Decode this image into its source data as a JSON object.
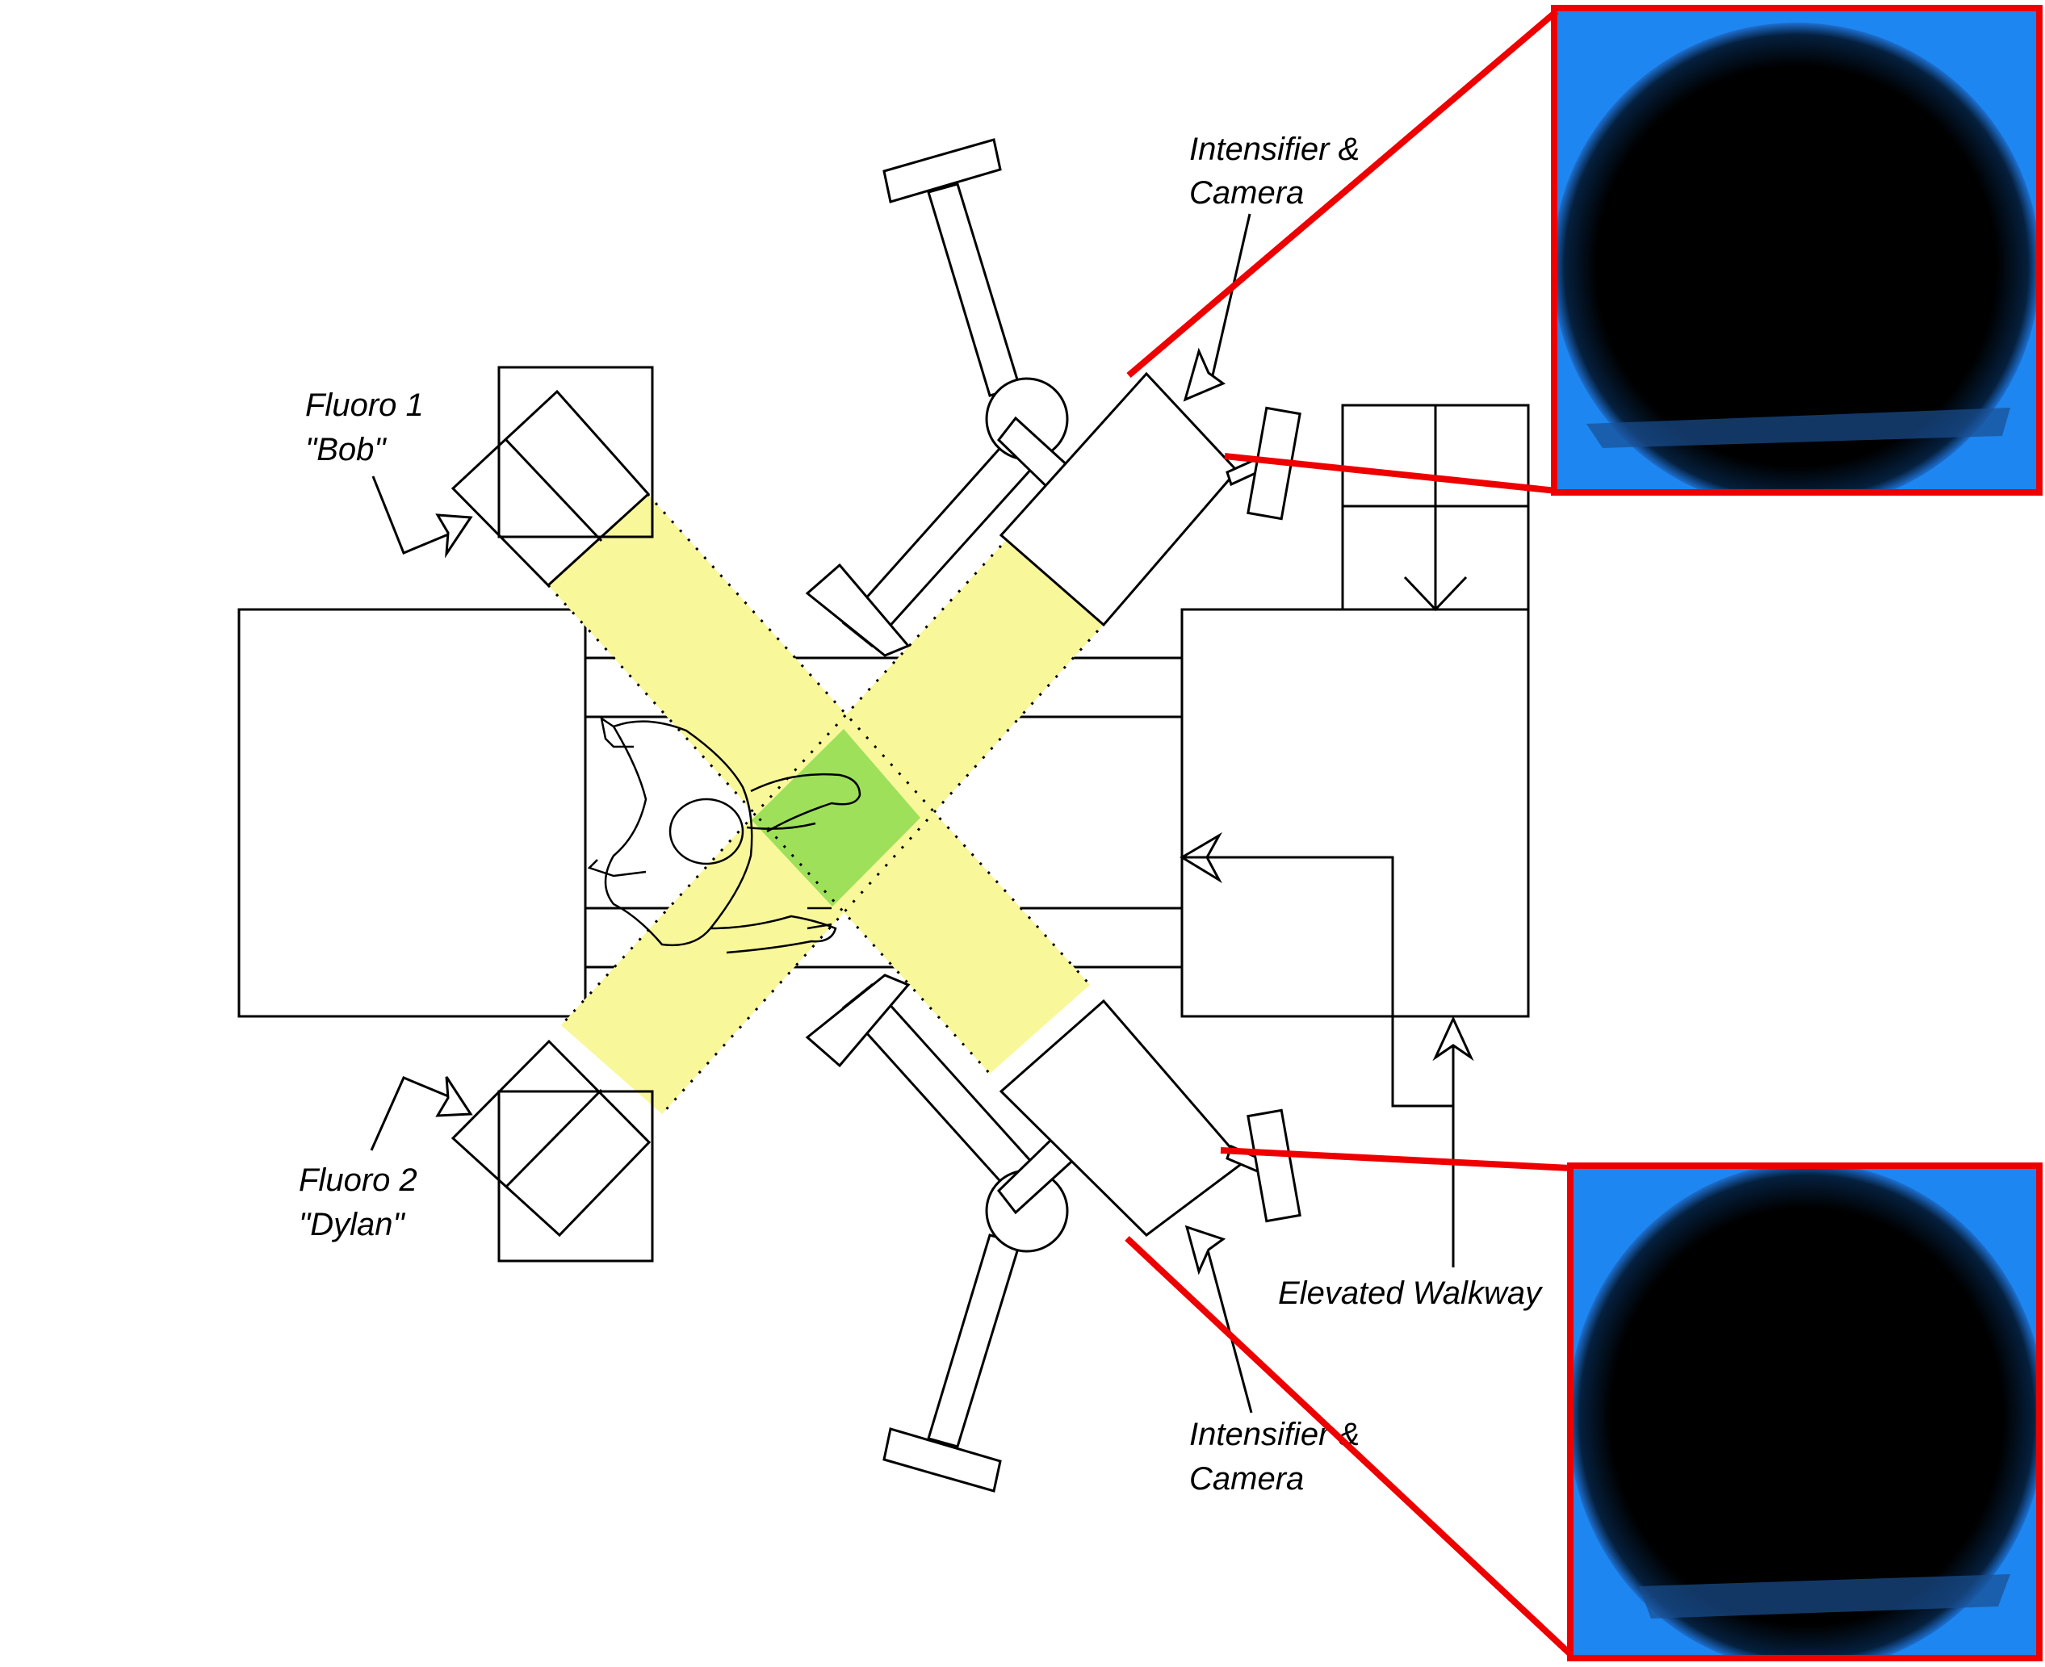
{
  "labels": {
    "fluoro1_line1": "Fluoro 1",
    "fluoro1_line2": "\"Bob\"",
    "fluoro2_line1": "Fluoro 2",
    "fluoro2_line2": "\"Dylan\"",
    "intensifier_top_line1": "Intensifier &",
    "intensifier_top_line2": "Camera",
    "intensifier_bottom_line1": "Intensifier &",
    "intensifier_bottom_line2": "Camera",
    "elevated_walkway": "Elevated Walkway"
  },
  "colors": {
    "beam": "#f8f89a",
    "overlap": "#9ee05a",
    "callout": "#ee0000",
    "xray_background": "#1d86f0",
    "xray_field": "#000000"
  },
  "icons": {
    "subject": "walking-person-icon"
  }
}
